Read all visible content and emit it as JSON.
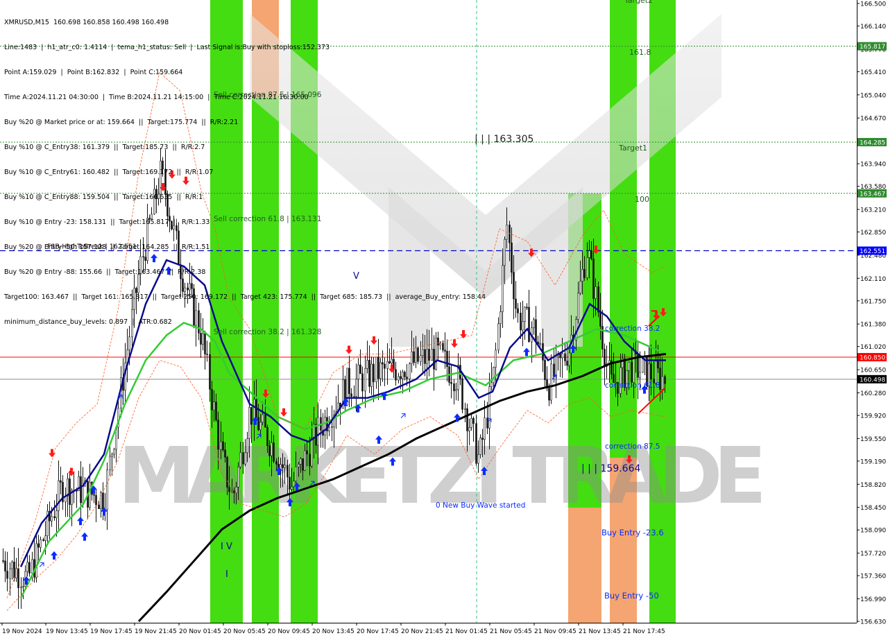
{
  "header": {
    "title": "XMRUSD,M15  160.698 160.858 160.498 160.498",
    "lines": [
      "Line:1483  |  h1_atr_c0: 1.4114  |  tema_h1_status: Sell  |  Last Signal is:Buy with stoploss:152.373",
      "Point A:159.029  |  Point B:162.832  |  Point C:159.664",
      "Time A:2024.11.21 04:30:00  |  Time B:2024.11.21 14:15:00  |  Time C:2024.11.21 16:30:00",
      "Buy %20 @ Market price or at: 159.664  ||  Target:175.774  ||  R/R:2.21",
      "Buy %10 @ C_Entry38: 161.379  ||  Target:185.73  ||  R/R:2.7",
      "Buy %10 @ C_Entry61: 160.482  ||  Target:169.172  ||  R/R:1.07",
      "Buy %10 @ C_Entry88: 159.504  ||  Target:166.635  ||  R/R:1",
      "Buy %10 @ Entry -23: 158.131  ||  Target:165.817  ||  R/R:1.33",
      "Buy %20 @ Entry -50: 157.128  ||  Target:164.285  ||  R/R:1.51",
      "Buy %20 @ Entry -88: 155.66  ||  Target:163.467  ||  R/R:2.38",
      "Target100: 163.467  ||  Target 161: 165.817  ||  Target 250: 169.172  ||  Target 423: 175.774  ||  Target 685: 185.73  ||  average_Buy_entry: 158.44",
      "minimum_distance_buy_levels: 0.897  |  ATR:0.682"
    ]
  },
  "price_axis": {
    "ticks": [
      "166.500",
      "166.140",
      "165.770",
      "165.410",
      "165.040",
      "164.670",
      "164.310",
      "163.940",
      "163.580",
      "163.210",
      "162.850",
      "162.480",
      "162.110",
      "161.750",
      "161.380",
      "161.020",
      "160.650",
      "160.280",
      "159.920",
      "159.550",
      "159.190",
      "158.820",
      "158.450",
      "158.090",
      "157.720",
      "157.360",
      "156.990",
      "156.630"
    ],
    "tick_values": [
      166.5,
      166.14,
      165.77,
      165.41,
      165.04,
      164.67,
      164.31,
      163.94,
      163.58,
      163.21,
      162.85,
      162.48,
      162.11,
      161.75,
      161.38,
      161.02,
      160.65,
      160.28,
      159.92,
      159.55,
      159.19,
      158.82,
      158.45,
      158.09,
      157.72,
      157.36,
      156.99,
      156.63
    ],
    "min": 156.63,
    "max": 166.5,
    "current_price": {
      "text": "160.498",
      "value": 160.498
    },
    "tags": [
      {
        "text": "165.817",
        "value": 165.817,
        "color": "#2e8b2e"
      },
      {
        "text": "164.285",
        "value": 164.285,
        "color": "#2e8b2e"
      },
      {
        "text": "163.467",
        "value": 163.467,
        "color": "#2e8b2e"
      },
      {
        "text": "162.551",
        "value": 162.551,
        "color": "#0000ff"
      },
      {
        "text": "160.850",
        "value": 160.85,
        "color": "#ff0000"
      }
    ]
  },
  "time_axis": {
    "labels": [
      "19 Nov 2024",
      "19 Nov 13:45",
      "19 Nov 17:45",
      "19 Nov 21:45",
      "20 Nov 01:45",
      "20 Nov 05:45",
      "20 Nov 09:45",
      "20 Nov 13:45",
      "20 Nov 17:45",
      "20 Nov 21:45",
      "21 Nov 01:45",
      "21 Nov 05:45",
      "21 Nov 09:45",
      "21 Nov 13:45",
      "21 Nov 17:45"
    ]
  },
  "annotations": {
    "fsb_label": "FSB-HighToBreak  |  162.551",
    "sell_correction_875": "Sell correction 87.5 | 165.096",
    "sell_correction_618": "Sell correction 61.8 | 163.131",
    "sell_correction_382": "Sell correction 38.2 | 161.328",
    "wave_label_top": "| | | 163.305",
    "wave_label_bottom": "| | | 159.664",
    "level_1618": "161.8",
    "target1": "Target1",
    "level_100": "100",
    "target2": "Target2",
    "correction_382": "correction 38.2",
    "correction_618": "correction 61.8",
    "correction_875": "correction 87.5",
    "buy_entry_236": "Buy Entry -23.6",
    "buy_entry_50": "Buy Entry -50",
    "new_buy_wave": "0 New Buy Wave started",
    "wave_v": "V",
    "wave_iv": "I V",
    "wave_i": "I",
    "watermark": "MARKETZI TRADE"
  },
  "colors": {
    "zone_green": "#44dd11",
    "zone_orange": "#f5a571",
    "bull_candle": "#2a2a2a",
    "ma_blue": "#0a0a8c",
    "ma_green": "#33cc33",
    "ma_black": "#000000",
    "buy_arrow": "#0a2cff",
    "sell_arrow": "#ff1a1a",
    "fsb_line": "#0000cc",
    "current_line": "#ff0000",
    "target_line": "#2e8b2e"
  }
}
